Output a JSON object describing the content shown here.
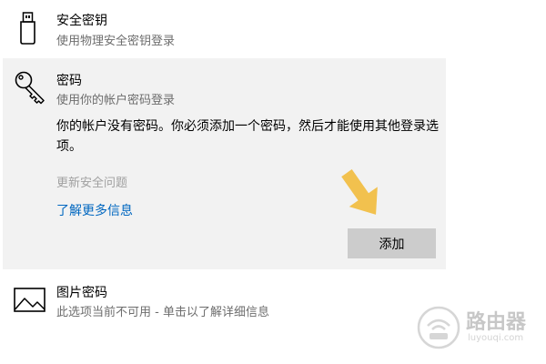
{
  "security_key": {
    "title": "安全密钥",
    "subtitle": "使用物理安全密钥登录",
    "icon": "usb-key-icon"
  },
  "password": {
    "title": "密码",
    "subtitle": "使用你的帐户密码登录",
    "icon": "key-icon",
    "description": "你的帐户没有密码。你必须添加一个密码，然后才能使用其他登录选项。",
    "update_security_questions": "更新安全问题",
    "learn_more": "了解更多信息",
    "add_button": "添加",
    "arrow_color": "#f2c14e"
  },
  "picture_password": {
    "title": "图片密码",
    "subtitle": "此选项当前不可用 - 单击以了解详细信息",
    "icon": "picture-icon"
  },
  "watermark": {
    "text": "路由器",
    "url": "luyouqi.com"
  }
}
